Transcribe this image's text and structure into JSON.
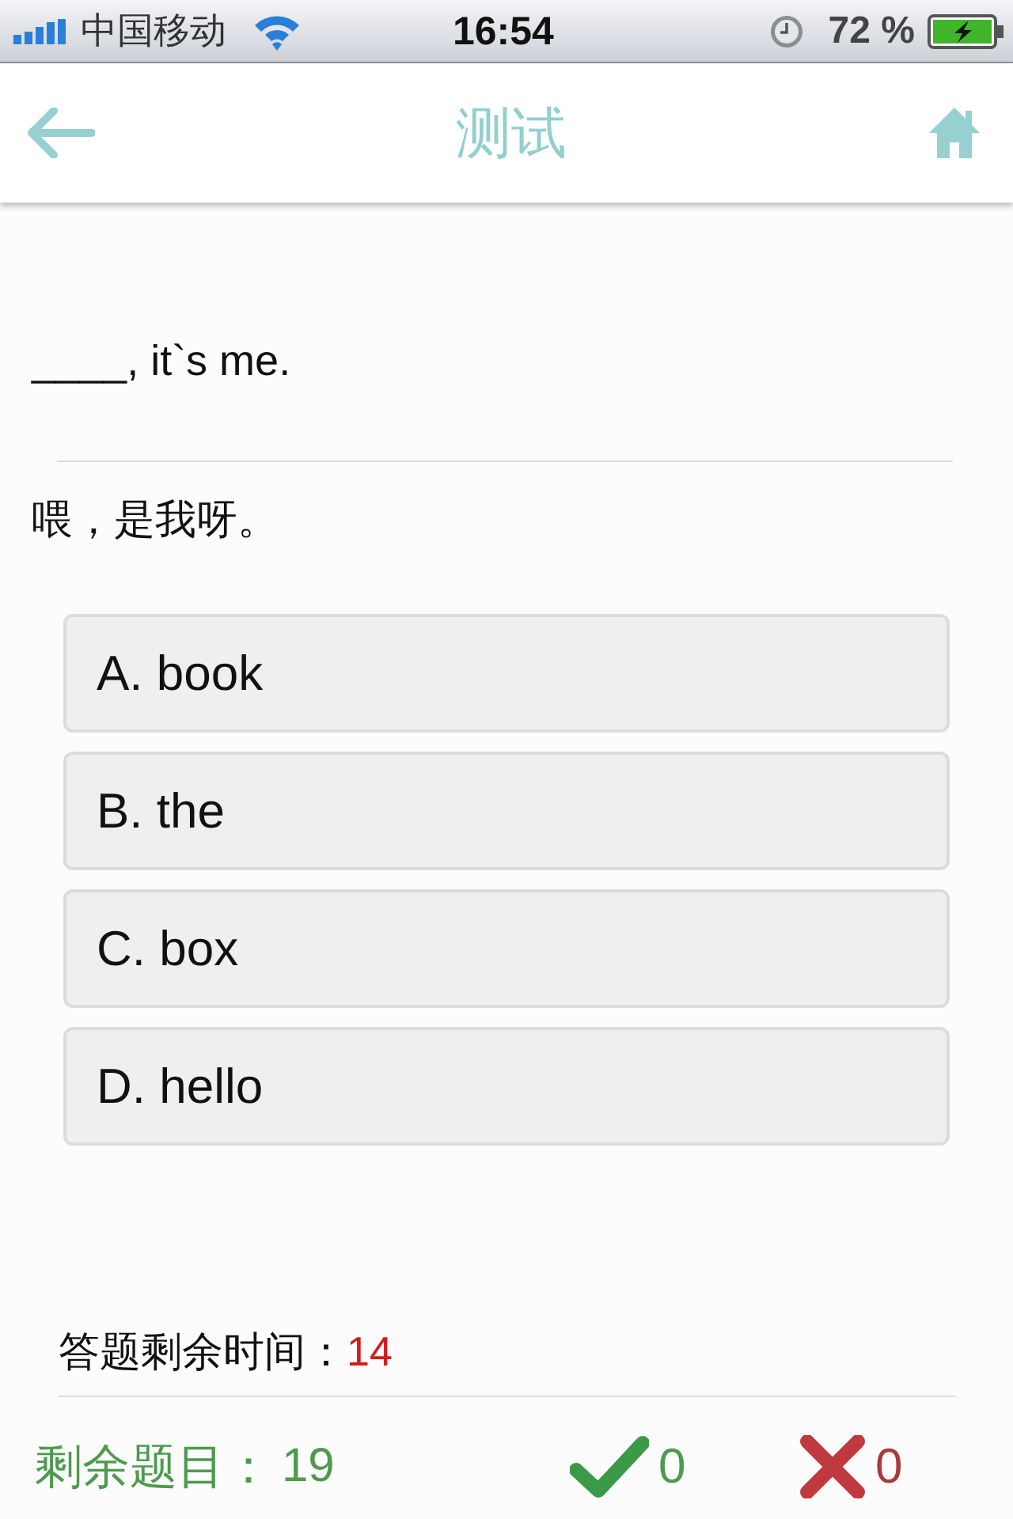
{
  "status_bar": {
    "carrier": "中国移动",
    "time": "16:54",
    "battery": "72 %"
  },
  "nav": {
    "title": "测试"
  },
  "question": {
    "text": "____, it`s me.",
    "translation": "喂，是我呀。"
  },
  "options": [
    {
      "text": "A. book",
      "selected": false
    },
    {
      "text": "B. the",
      "selected": false
    },
    {
      "text": "C. box",
      "selected": false
    },
    {
      "text": "D. hello",
      "selected": false
    }
  ],
  "timer": {
    "label": "答题剩余时间：",
    "value": "14"
  },
  "footer": {
    "remaining_label": "剩余题目：",
    "remaining": "19",
    "correct": "0",
    "wrong": "0"
  }
}
